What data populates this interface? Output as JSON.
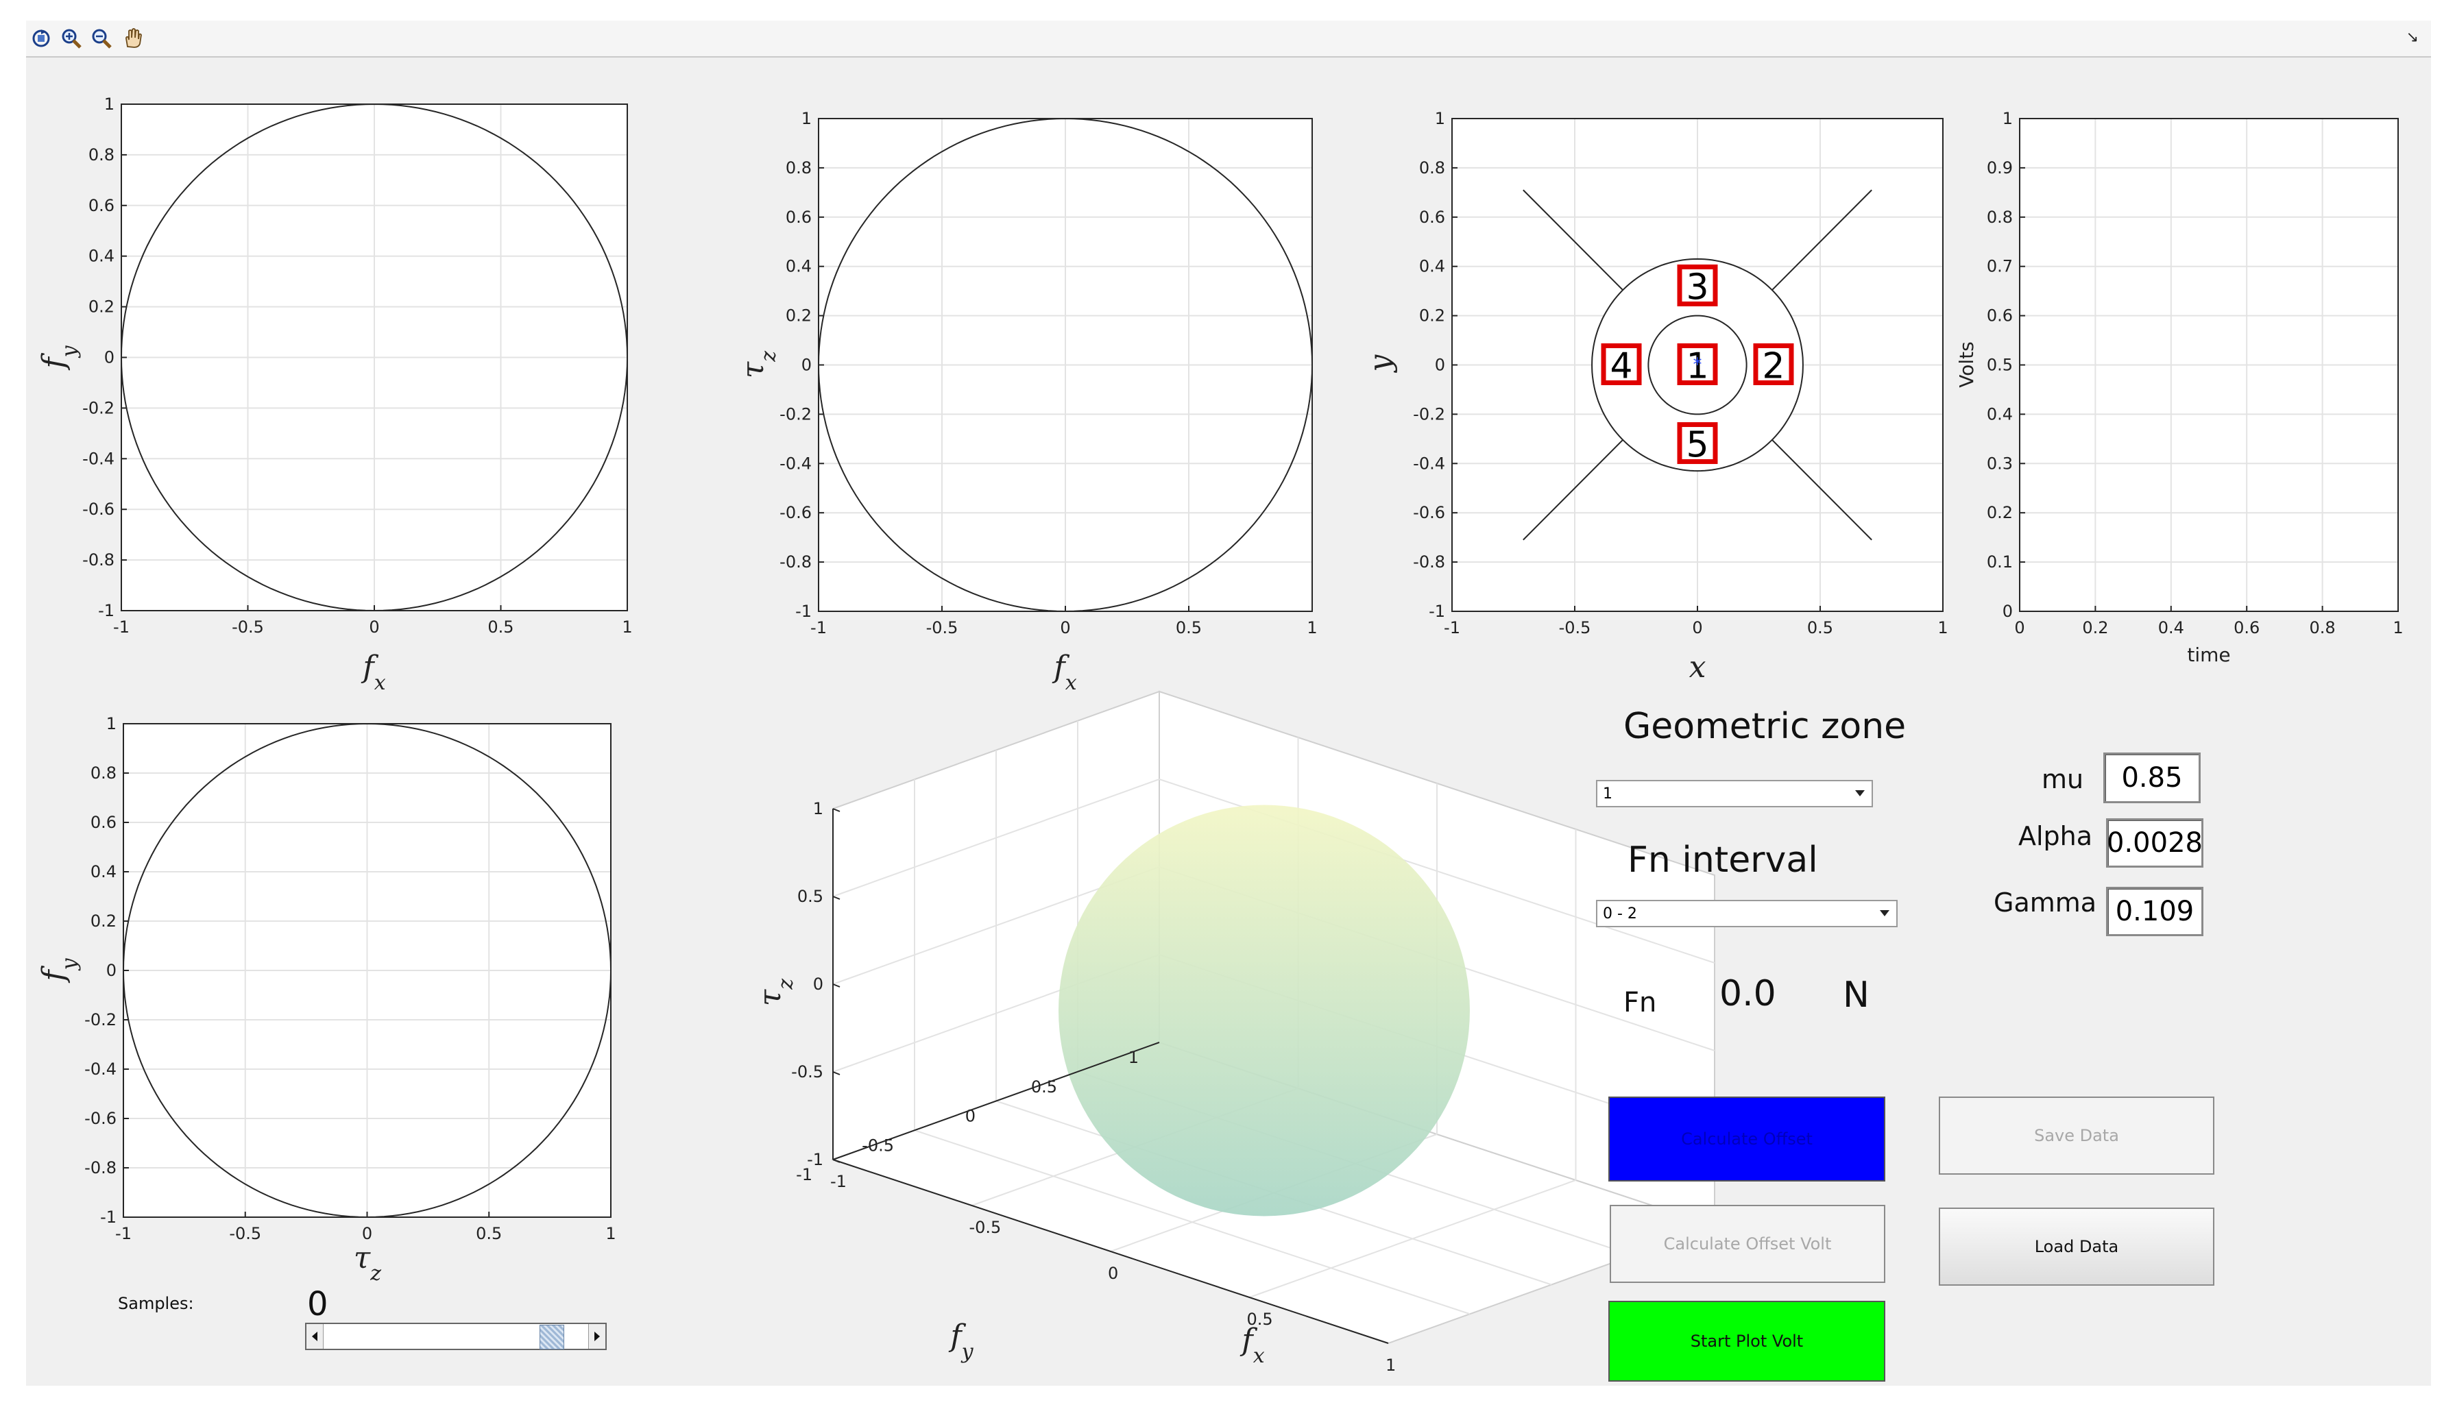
{
  "toolbar": {
    "icons": [
      "rotate-3d-icon",
      "zoom-in-icon",
      "zoom-out-icon",
      "pan-hand-icon"
    ],
    "menu_arrow": "↘"
  },
  "ticks": {
    "sym": [
      "-1",
      "-0.8",
      "-0.6",
      "-0.4",
      "-0.2",
      "0",
      "0.2",
      "0.4",
      "0.6",
      "0.8",
      "1"
    ],
    "sym_x": [
      "-1",
      "-0.5",
      "0",
      "0.5",
      "1"
    ],
    "volts_y": [
      "0",
      "0.1",
      "0.2",
      "0.3",
      "0.4",
      "0.5",
      "0.6",
      "0.7",
      "0.8",
      "0.9",
      "1"
    ],
    "time_x": [
      "0",
      "0.2",
      "0.4",
      "0.6",
      "0.8",
      "1"
    ],
    "s3d_z": [
      "-1",
      "-0.5",
      "0",
      "0.5",
      "1"
    ],
    "s3d_fy": [
      "-1",
      "-0.5",
      "0",
      "0.5",
      "1"
    ],
    "s3d_fx": [
      "-1",
      "-0.5",
      "0",
      "0.5",
      "1"
    ]
  },
  "plots": {
    "p1": {
      "xlabel": "f",
      "xsub": "x",
      "ylabel": "f",
      "ysub": "y"
    },
    "p2": {
      "xlabel": "f",
      "xsub": "x",
      "ylabel": "τ",
      "ysub": "z"
    },
    "p3": {
      "xlabel": "x",
      "ylabel": "y",
      "zones": [
        "1",
        "2",
        "3",
        "4",
        "5"
      ]
    },
    "p4": {
      "xlabel": "time",
      "ylabel": "Volts"
    },
    "p5": {
      "xlabel": "τ",
      "xsub": "z",
      "ylabel": "f",
      "ysub": "y"
    },
    "p6": {
      "xlabel": "f",
      "xsub": "x",
      "ylabel": "f",
      "ysub": "y",
      "zlabel": "τ",
      "zsub": "z"
    }
  },
  "chart_data": [
    {
      "type": "line",
      "name_id": "fx-fy-plot",
      "xlim": [
        -1,
        1
      ],
      "ylim": [
        -1,
        1
      ],
      "grid": true,
      "curve": "unit-circle"
    },
    {
      "type": "line",
      "name_id": "fx-tauz-plot",
      "xlim": [
        -1,
        1
      ],
      "ylim": [
        -1,
        1
      ],
      "grid": true,
      "curve": "unit-circle"
    },
    {
      "type": "line",
      "name_id": "xy-zone-plot",
      "xlim": [
        -1,
        1
      ],
      "ylim": [
        -1,
        1
      ],
      "grid": true,
      "circles_r": [
        0.2,
        0.43
      ],
      "diagonals_extent": 0.71,
      "zones": [
        {
          "label": "1",
          "x": 0,
          "y": 0
        },
        {
          "label": "2",
          "x": 0.31,
          "y": 0
        },
        {
          "label": "3",
          "x": 0,
          "y": 0.32
        },
        {
          "label": "4",
          "x": -0.31,
          "y": 0
        },
        {
          "label": "5",
          "x": 0,
          "y": -0.32
        }
      ],
      "marker": {
        "x": 0,
        "y": 0
      }
    },
    {
      "type": "line",
      "name_id": "volts-time-plot",
      "xlim": [
        0,
        1
      ],
      "ylim": [
        0,
        1
      ],
      "grid": true,
      "series": []
    },
    {
      "type": "line",
      "name_id": "tauz-fy-plot",
      "xlim": [
        -1,
        1
      ],
      "ylim": [
        -1,
        1
      ],
      "grid": true,
      "curve": "unit-circle"
    },
    {
      "type": "scatter",
      "name_id": "sphere-3d-plot",
      "xlim": [
        -1,
        1
      ],
      "ylim": [
        -1,
        1
      ],
      "zlim": [
        -1,
        1
      ],
      "surface": "unit-sphere"
    }
  ],
  "controls": {
    "geometric_zone_title": "Geometric zone",
    "zone_selected": "1",
    "fn_interval_title": "Fn interval",
    "fn_interval_selected": "0 - 2",
    "fn_label": "Fn",
    "fn_value": "0.0",
    "fn_unit": "N",
    "mu_label": "mu",
    "mu_value": "0.85",
    "alpha_label": "Alpha",
    "alpha_value": "0.0028",
    "gamma_label": "Gamma",
    "gamma_value": "0.109",
    "samples_label": "Samples:",
    "samples_value": "0"
  },
  "buttons": {
    "calculate_offset": "Calculate Offset",
    "calculate_offset_volt": "Calculate Offset Volt",
    "start_plot_volt": "Start Plot Volt",
    "save_data": "Save Data",
    "load_data": "Load Data"
  },
  "colors": {
    "calculate_offset_bg": "#0000ff",
    "start_plot_volt_bg": "#00ff00",
    "zone_box": "#e00000",
    "sphere_top": "#f2f6c6",
    "sphere_bottom": "#a9d6c6"
  }
}
